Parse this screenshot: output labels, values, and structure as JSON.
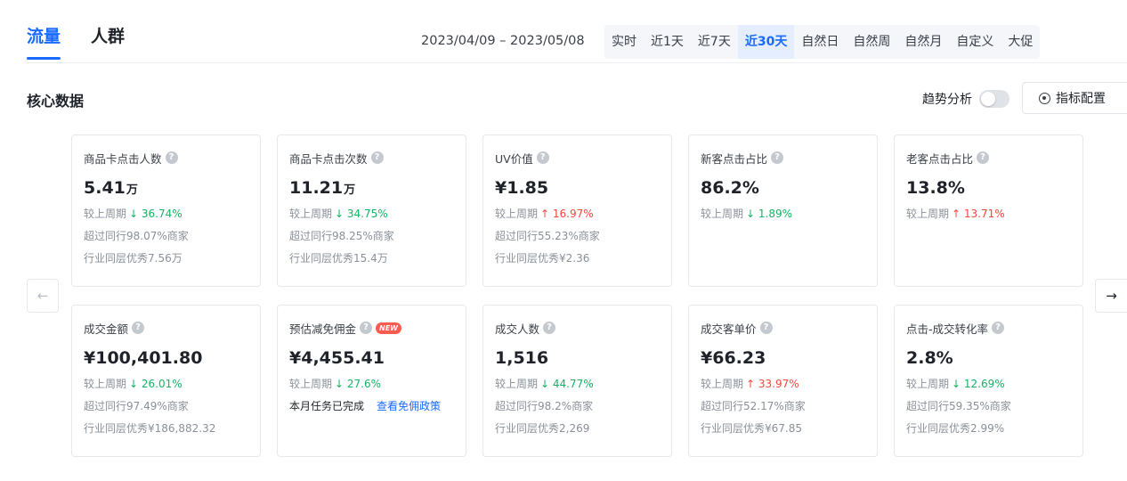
{
  "tabs": [
    {
      "label": "流量",
      "active": true
    },
    {
      "label": "人群",
      "active": false
    }
  ],
  "date_range": "2023/04/09 – 2023/05/08",
  "range_options": [
    {
      "label": "实时",
      "active": false
    },
    {
      "label": "近1天",
      "active": false
    },
    {
      "label": "近7天",
      "active": false
    },
    {
      "label": "近30天",
      "active": true
    },
    {
      "label": "自然日",
      "active": false
    },
    {
      "label": "自然周",
      "active": false
    },
    {
      "label": "自然月",
      "active": false
    },
    {
      "label": "自定义",
      "active": false
    },
    {
      "label": "大促",
      "active": false
    }
  ],
  "section": {
    "title": "核心数据",
    "trend_label": "趋势分析",
    "trend_enabled": false,
    "config_label": "指标配置"
  },
  "arrows": {
    "prev": "←",
    "next": "→"
  },
  "help_glyph": "?",
  "new_badge": "NEW",
  "compare_label": "较上周期",
  "colors": {
    "accent": "#1a6bff",
    "down": "#16b364",
    "up": "#f5463c"
  },
  "cards": [
    {
      "title": "商品卡点击人数",
      "value": "5.41",
      "unit": "万",
      "change": "36.74%",
      "direction": "down",
      "arrow": "↓",
      "peer": "超过同行98.07%商家",
      "excellent": "行业同层优秀7.56万"
    },
    {
      "title": "商品卡点击次数",
      "value": "11.21",
      "unit": "万",
      "change": "34.75%",
      "direction": "down",
      "arrow": "↓",
      "peer": "超过同行98.25%商家",
      "excellent": "行业同层优秀15.4万"
    },
    {
      "title": "UV价值",
      "value": "¥1.85",
      "unit": "",
      "change": "16.97%",
      "direction": "up",
      "arrow": "↑",
      "peer": "超过同行55.23%商家",
      "excellent": "行业同层优秀¥2.36"
    },
    {
      "title": "新客点击占比",
      "value": "86.2%",
      "unit": "",
      "change": "1.89%",
      "direction": "down",
      "arrow": "↓",
      "peer": "",
      "excellent": ""
    },
    {
      "title": "老客点击占比",
      "value": "13.8%",
      "unit": "",
      "change": "13.71%",
      "direction": "up",
      "arrow": "↑",
      "peer": "",
      "excellent": ""
    },
    {
      "title": "成交金额",
      "value": "¥100,401.80",
      "unit": "",
      "change": "26.01%",
      "direction": "down",
      "arrow": "↓",
      "peer": "超过同行97.49%商家",
      "excellent": "行业同层优秀¥186,882.32"
    },
    {
      "title": "预估减免佣金",
      "value": "¥4,455.41",
      "unit": "",
      "change": "27.6%",
      "direction": "down",
      "arrow": "↓",
      "is_new": true,
      "task_text": "本月任务已完成",
      "task_link": "查看免佣政策"
    },
    {
      "title": "成交人数",
      "value": "1,516",
      "unit": "",
      "change": "44.77%",
      "direction": "down",
      "arrow": "↓",
      "peer": "超过同行98.2%商家",
      "excellent": "行业同层优秀2,269"
    },
    {
      "title": "成交客单价",
      "value": "¥66.23",
      "unit": "",
      "change": "33.97%",
      "direction": "up",
      "arrow": "↑",
      "peer": "超过同行52.17%商家",
      "excellent": "行业同层优秀¥67.85"
    },
    {
      "title": "点击-成交转化率",
      "value": "2.8%",
      "unit": "",
      "change": "12.69%",
      "direction": "down",
      "arrow": "↓",
      "peer": "超过同行59.35%商家",
      "excellent": "行业同层优秀2.99%"
    }
  ]
}
